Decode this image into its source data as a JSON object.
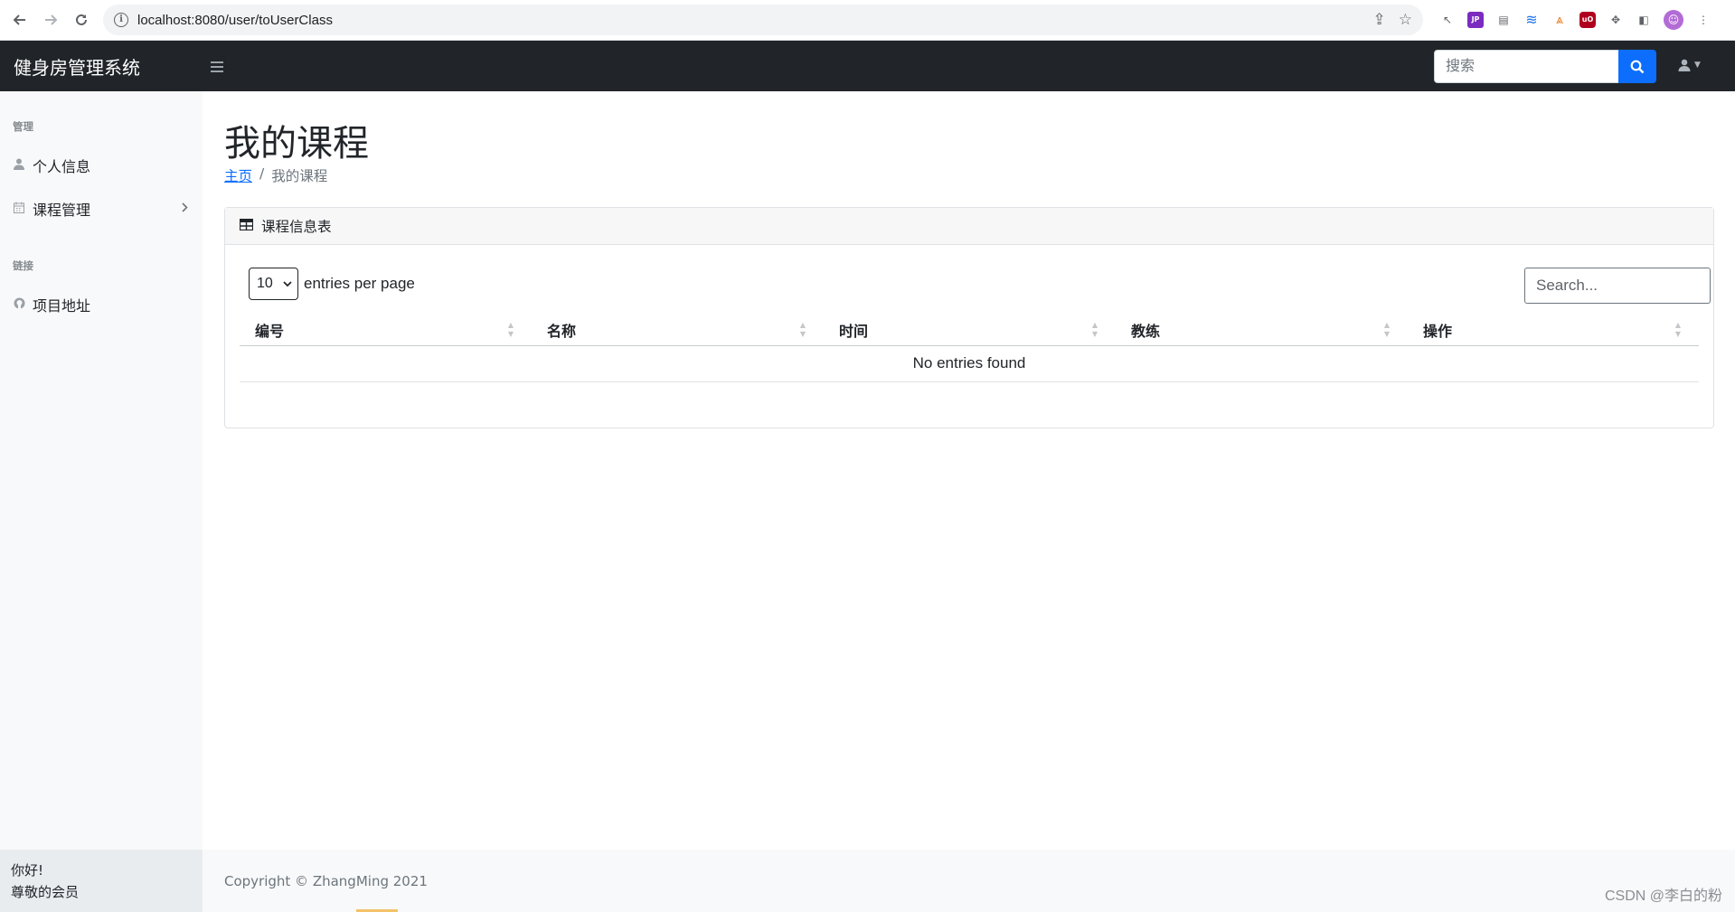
{
  "browser": {
    "url": "localhost:8080/user/toUserClass",
    "back_icon": "arrow-left-icon",
    "forward_icon": "arrow-right-icon",
    "reload_icon": "reload-icon"
  },
  "navbar": {
    "brand": "健身房管理系统",
    "search_placeholder": "搜索",
    "accent_color": "#0d6efd",
    "background_color": "#212529"
  },
  "sidebar": {
    "sections": [
      {
        "heading": "管理",
        "items": [
          {
            "label": "个人信息",
            "icon": "user-icon"
          },
          {
            "label": "课程管理",
            "icon": "calendar-icon",
            "has_submenu": true
          }
        ]
      },
      {
        "heading": "链接",
        "items": [
          {
            "label": "项目地址",
            "icon": "github-icon"
          }
        ]
      }
    ],
    "footer": {
      "greeting": "你好!",
      "role": "尊敬的会员"
    }
  },
  "main": {
    "title": "我的课程",
    "breadcrumb": {
      "home": "主页",
      "current": "我的课程",
      "separator": "/"
    },
    "card": {
      "header": "课程信息表",
      "entries_value": "10",
      "entries_label": "entries per page",
      "search_placeholder": "Search...",
      "columns": [
        "编号",
        "名称",
        "时间",
        "教练",
        "操作"
      ],
      "empty_message": "No entries found"
    },
    "footer": "Copyright © ZhangMing 2021"
  },
  "watermark": "CSDN @李白的粉"
}
